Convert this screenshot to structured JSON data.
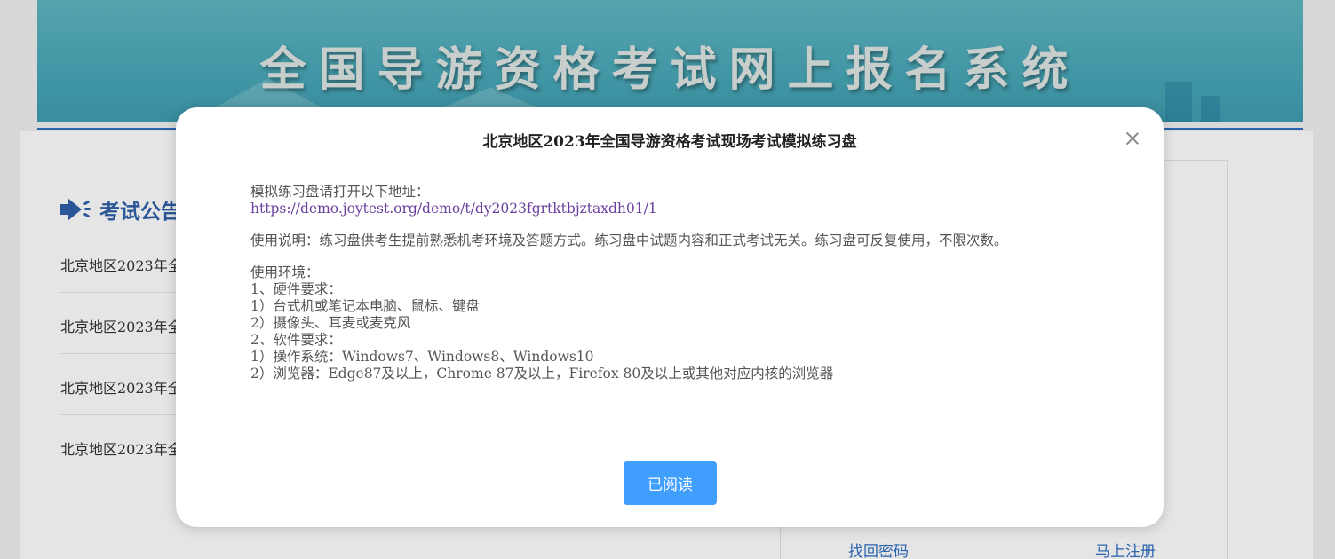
{
  "banner": {
    "title": "全国导游资格考试网上报名系统"
  },
  "notices": {
    "title": "考试公告",
    "items": [
      "北京地区2023年全",
      "北京地区2023年全",
      "北京地区2023年全",
      "北京地区2023年全"
    ]
  },
  "login": {
    "forgot_password": "找回密码",
    "register": "马上注册"
  },
  "modal": {
    "title": "北京地区2023年全国导游资格考试现场考试模拟练习盘",
    "address_intro": "模拟练习盘请打开以下地址：",
    "address_link": "https://demo.joytest.org/demo/t/dy2023fgrtktbjztaxdh01/1",
    "usage_note": "使用说明：练习盘供考生提前熟悉机考环境及答题方式。练习盘中试题内容和正式考试无关。练习盘可反复使用，不限次数。",
    "env_title": "使用环境：",
    "env_lines": [
      "1、硬件要求：",
      "1）台式机或笔记本电脑、鼠标、键盘",
      "2）摄像头、耳麦或麦克风",
      "2、软件要求：",
      "1）操作系统：Windows7、Windows8、Windows10",
      "2）浏览器：Edge87及以上，Chrome 87及以上，Firefox 80及以上或其他对应内核的浏览器"
    ],
    "confirm_label": "已阅读"
  },
  "colors": {
    "accent": "#409eff",
    "brand_blue": "#2f5fa8",
    "banner_teal": "#4aa8b8",
    "link_purple": "#6a3fa0"
  }
}
